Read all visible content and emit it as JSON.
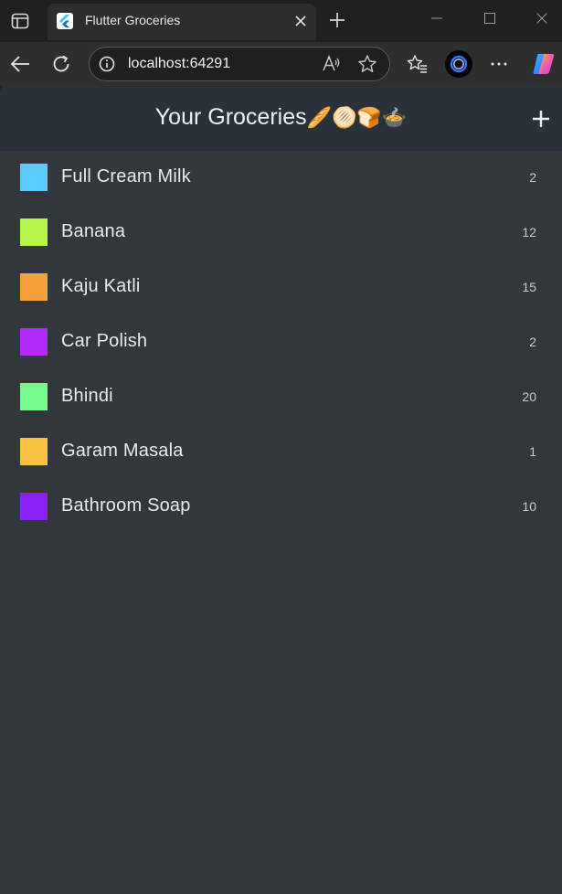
{
  "browser": {
    "tab_title": "Flutter Groceries",
    "url": "localhost:64291",
    "icons": {
      "tab_actions": "tab-actions-icon",
      "favicon": "flutter-logo-icon",
      "tab_close": "close-icon",
      "new_tab": "plus-icon",
      "minimize": "minimize-icon",
      "maximize": "maximize-icon",
      "close_window": "close-icon",
      "back": "back-arrow-icon",
      "refresh": "refresh-icon",
      "site_info": "info-icon",
      "read_aloud": "read-aloud-icon",
      "favorite": "star-icon",
      "favorites_list": "favorites-icon",
      "profile": "profile-avatar-icon",
      "more": "more-icon",
      "copilot": "copilot-icon"
    }
  },
  "app": {
    "title": "Your Groceries",
    "title_emoji": "🥖🫓🍞🍲",
    "add_icon": "plus-icon",
    "colors": {
      "background": "#32373b",
      "appbar": "#2b3138",
      "text": "#e8eaec"
    },
    "groceries": [
      {
        "name": "Full Cream Milk",
        "quantity": "2",
        "color": "#5ccbff"
      },
      {
        "name": "Banana",
        "quantity": "12",
        "color": "#b4f54a"
      },
      {
        "name": "Kaju Katli",
        "quantity": "15",
        "color": "#f6a03c"
      },
      {
        "name": "Car Polish",
        "quantity": "2",
        "color": "#b02afa"
      },
      {
        "name": "Bhindi",
        "quantity": "20",
        "color": "#74fc8f"
      },
      {
        "name": "Garam Masala",
        "quantity": "1",
        "color": "#fbc241"
      },
      {
        "name": "Bathroom Soap",
        "quantity": "10",
        "color": "#8b22f5"
      }
    ]
  }
}
